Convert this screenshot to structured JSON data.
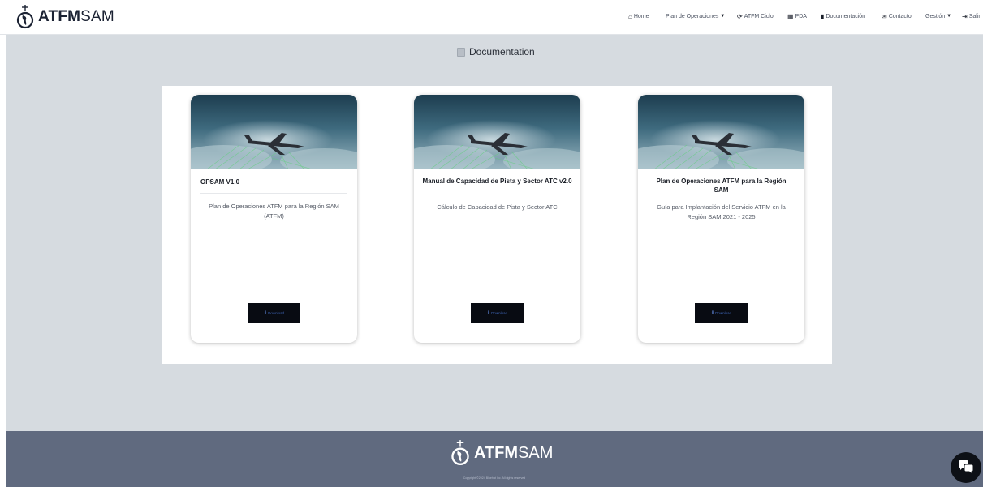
{
  "brand": {
    "name_bold": "ATFM",
    "name_light": "SAM"
  },
  "nav": {
    "home": "Home",
    "plan": "Plan de Operaciones",
    "ciclo": "ATFM Ciclo",
    "pda": "PDA",
    "documentacion": "Documentación",
    "contacto": "Contacto",
    "gestion": "Gestión",
    "salir": "Salir"
  },
  "page": {
    "title": "Documentation"
  },
  "cards": [
    {
      "title": "OPSAM V1.0",
      "description": "Plan de Operaciones ATFM para la Región SAM (ATFM)",
      "button": "Download"
    },
    {
      "title": "Manual de Capacidad de Pista y Sector ATC v2.0",
      "description": "Cálculo de Capacidad de Pista y Sector ATC",
      "button": "Download"
    },
    {
      "title": "Plan de Operaciones ATFM para la Región SAM",
      "description": "Guía para Implantación del Servicio ATFM en la Región SAM 2021 - 2025",
      "button": "Download"
    }
  ],
  "footer": {
    "brand_bold": "ATFM",
    "brand_light": "SAM",
    "copyright": "Copyright ©2024 Bluehat Inc. All rights reserved"
  },
  "icons": {
    "home": "home-icon",
    "refresh": "refresh-icon",
    "calendar": "calendar-icon",
    "book": "book-icon",
    "envelope": "envelope-icon",
    "sign_out": "sign-out-icon",
    "download": "download-icon",
    "chat": "chat-icon",
    "logo": "globe-plane-logo"
  },
  "colors": {
    "background": "#d6dbe0",
    "footer": "#606a7f",
    "button": "#080b12",
    "button_text": "#3f66b8"
  }
}
